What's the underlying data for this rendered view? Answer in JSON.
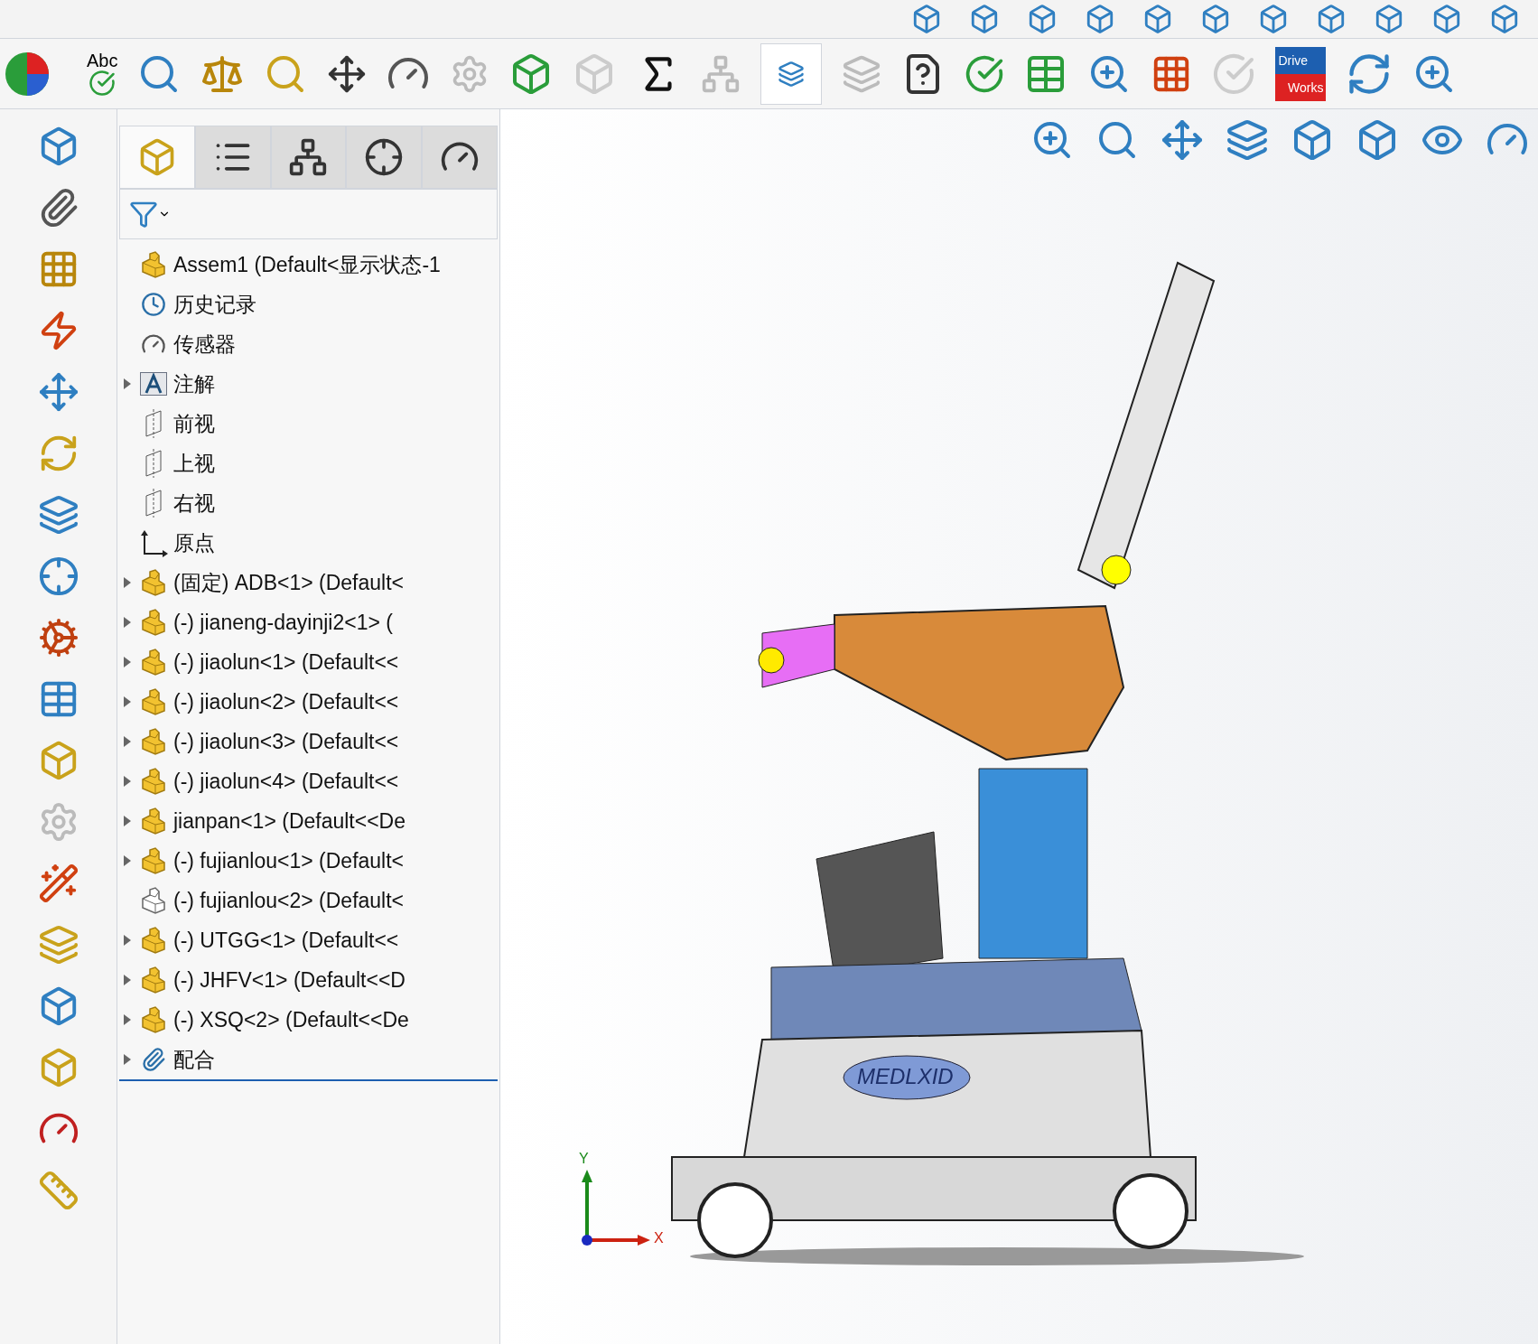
{
  "toolbar": {
    "spell_label": "Abc",
    "driveworks_logo": [
      "Drive",
      "Works"
    ]
  },
  "panel_tabs": [
    {
      "selected": true
    },
    {
      "selected": false
    },
    {
      "selected": false
    },
    {
      "selected": false
    },
    {
      "selected": false
    }
  ],
  "tree": {
    "label": "Assem1  (Default<显示状态-1",
    "children": [
      {
        "kind": "history",
        "label": "历史记录",
        "expandable": false
      },
      {
        "kind": "sensors",
        "label": "传感器",
        "expandable": false
      },
      {
        "kind": "annotations",
        "label": "注解",
        "expandable": true
      },
      {
        "kind": "plane",
        "label": "前视",
        "expandable": false
      },
      {
        "kind": "plane",
        "label": "上视",
        "expandable": false
      },
      {
        "kind": "plane",
        "label": "右视",
        "expandable": false
      },
      {
        "kind": "origin",
        "label": "原点",
        "expandable": false
      },
      {
        "kind": "part",
        "label": "(固定) ADB<1> (Default<",
        "expandable": true,
        "hidden": false
      },
      {
        "kind": "part",
        "label": "(-) jianeng-dayinji2<1> (",
        "expandable": true,
        "hidden": false
      },
      {
        "kind": "part",
        "label": "(-) jiaolun<1> (Default<<",
        "expandable": true,
        "hidden": false
      },
      {
        "kind": "part",
        "label": "(-) jiaolun<2> (Default<<",
        "expandable": true,
        "hidden": false
      },
      {
        "kind": "part",
        "label": "(-) jiaolun<3> (Default<<",
        "expandable": true,
        "hidden": false
      },
      {
        "kind": "part",
        "label": "(-) jiaolun<4> (Default<<",
        "expandable": true,
        "hidden": false
      },
      {
        "kind": "part",
        "label": "jianpan<1> (Default<<De",
        "expandable": true,
        "hidden": false
      },
      {
        "kind": "part",
        "label": "(-) fujianlou<1> (Default<",
        "expandable": true,
        "hidden": false
      },
      {
        "kind": "part",
        "label": "(-) fujianlou<2> (Default<",
        "expandable": false,
        "hidden": true
      },
      {
        "kind": "part",
        "label": "(-) UTGG<1> (Default<<",
        "expandable": true,
        "hidden": false
      },
      {
        "kind": "part",
        "label": "(-) JHFV<1> (Default<<D",
        "expandable": true,
        "hidden": false
      },
      {
        "kind": "part",
        "label": "(-) XSQ<2> (Default<<De",
        "expandable": true,
        "hidden": false
      },
      {
        "kind": "mates",
        "label": "配合",
        "expandable": true
      }
    ]
  },
  "viewport": {
    "model_logo": "MEDLXID",
    "axis_x": "X",
    "axis_y": "Y"
  }
}
